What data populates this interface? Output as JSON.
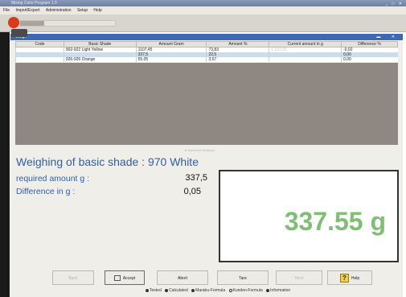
{
  "window": {
    "title": "Mixing Color Program 1.0"
  },
  "menu": [
    "File",
    "Import/Export",
    "Administration",
    "Setup",
    "Help"
  ],
  "panel": {
    "title": "Weigh"
  },
  "table": {
    "columns": [
      "Code",
      "Basic Shade",
      "Amount Gram",
      "Amount %",
      "Current amount in g",
      "Difference %"
    ],
    "rows": [
      [
        "",
        "902-922 Light Yellow",
        "1107,45",
        "73,83",
        "1 107,55",
        "-0,02"
      ],
      [
        "",
        "",
        "337,5",
        "22,5",
        "",
        "0,00"
      ],
      [
        "",
        "926-926 Orange",
        "55,05",
        "3,67",
        "",
        "0,00"
      ]
    ],
    "selected_row": 1
  },
  "legend_top": "● Manual  ● Weighed",
  "weighing": {
    "title": "Weighing of basic shade : 970 White",
    "required_label": "required amount g :",
    "required_value": "337,5",
    "difference_label": "Difference in g :",
    "difference_value": "0,05"
  },
  "display": {
    "value": "337.55 g",
    "color": "#7fbf74"
  },
  "buttons": {
    "back": "Back",
    "accept": "Accept",
    "abort": "Abort",
    "tare": "Tare",
    "next": "Next",
    "help": "Help"
  },
  "legend_bottom": [
    {
      "label": "Tested",
      "color": "#333333"
    },
    {
      "label": "Calculated",
      "color": "#333333"
    },
    {
      "label": "Marabu-Formula",
      "color": "#333333"
    },
    {
      "label": "Kunden-Formula",
      "color": "#ffffff"
    },
    {
      "label": "Information",
      "color": "#333333"
    }
  ],
  "colors": {
    "accent": "#3e68b5",
    "label_blue": "#2f5fa8",
    "grid_empty": "#8f8781",
    "logo": "#d83a1a"
  }
}
